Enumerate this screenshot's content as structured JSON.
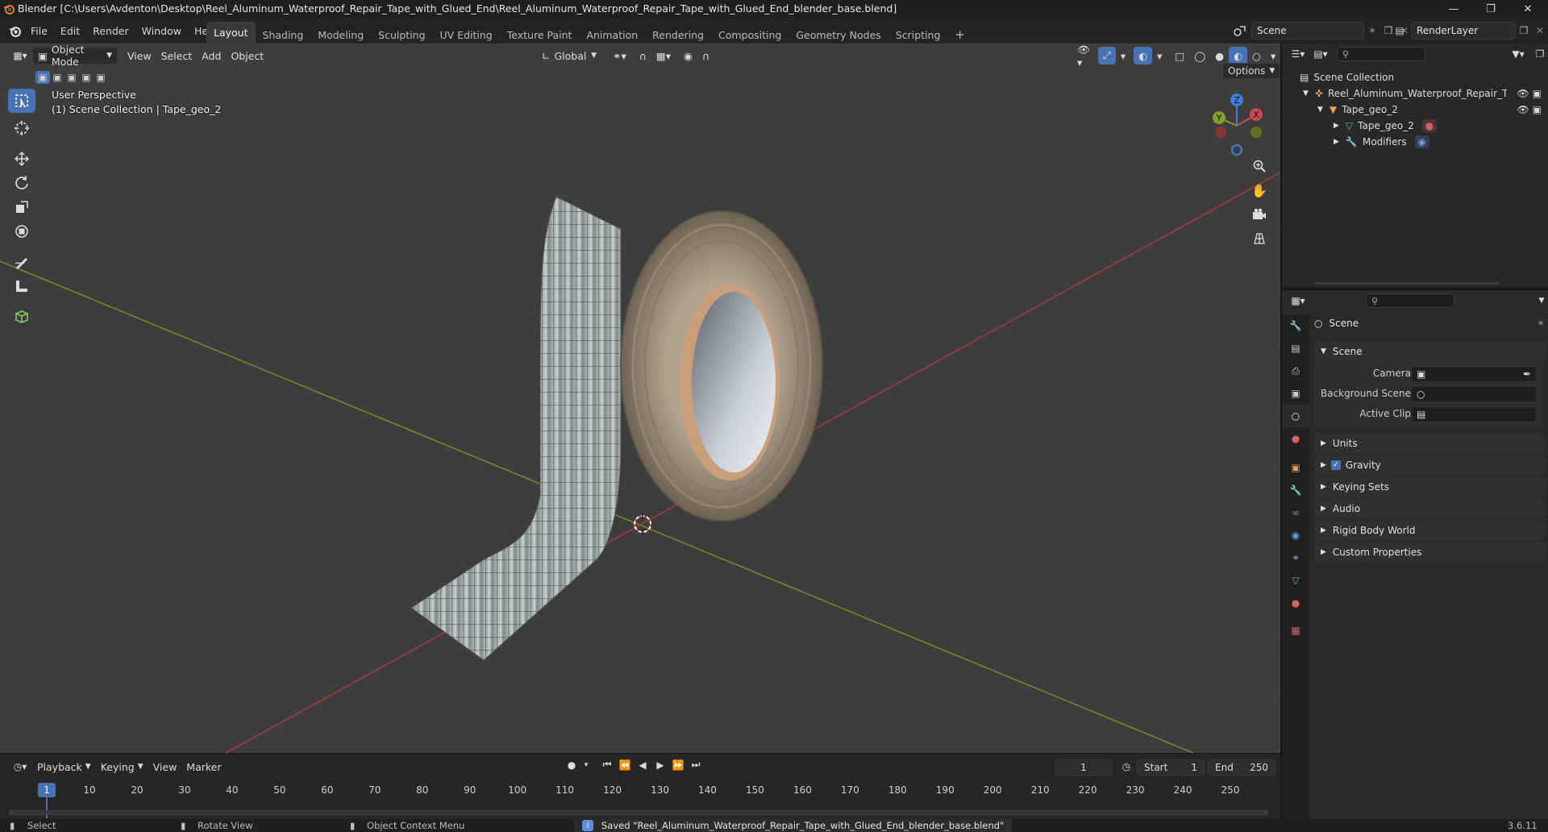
{
  "window": {
    "title": "Blender [C:\\Users\\Avdenton\\Desktop\\Reel_Aluminum_Waterproof_Repair_Tape_with_Glued_End\\Reel_Aluminum_Waterproof_Repair_Tape_with_Glued_End_blender_base.blend]"
  },
  "menubar": {
    "menus": [
      "File",
      "Edit",
      "Render",
      "Window",
      "Help"
    ],
    "workspaces": [
      "Layout",
      "Shading",
      "Modeling",
      "Sculpting",
      "UV Editing",
      "Texture Paint",
      "Animation",
      "Rendering",
      "Compositing",
      "Geometry Nodes",
      "Scripting"
    ],
    "active_workspace": "Layout",
    "scene_name": "Scene",
    "view_layer": "RenderLayer"
  },
  "viewport": {
    "mode": "Object Mode",
    "menus": [
      "View",
      "Select",
      "Add",
      "Object"
    ],
    "transform_orientation": "Global",
    "options_label": "Options",
    "perspective_label": "User Perspective",
    "collection_label": "(1) Scene Collection | Tape_geo_2",
    "gizmo_axes": {
      "x": "X",
      "y": "Y",
      "z": "Z"
    }
  },
  "outliner": {
    "root": "Scene Collection",
    "items": [
      {
        "label": "Reel_Aluminum_Waterproof_Repair_Tap",
        "depth": 1
      },
      {
        "label": "Tape_geo_2",
        "depth": 2
      },
      {
        "label": "Tape_geo_2",
        "depth": 3
      },
      {
        "label": "Modifiers",
        "depth": 3
      }
    ]
  },
  "properties": {
    "context_title": "Scene",
    "section_title": "Scene",
    "fields": [
      {
        "label": "Camera",
        "value": ""
      },
      {
        "label": "Background Scene",
        "value": ""
      },
      {
        "label": "Active Clip",
        "value": ""
      }
    ],
    "panels": [
      "Units",
      "Gravity",
      "Keying Sets",
      "Audio",
      "Rigid Body World",
      "Custom Properties"
    ],
    "gravity_checked": true
  },
  "timeline": {
    "menus": [
      "Playback",
      "Keying",
      "View",
      "Marker"
    ],
    "current_frame": "1",
    "start_label": "Start",
    "start_value": "1",
    "end_label": "End",
    "end_value": "250",
    "ticks": [
      "1",
      "10",
      "20",
      "30",
      "40",
      "50",
      "60",
      "70",
      "80",
      "90",
      "100",
      "110",
      "120",
      "130",
      "140",
      "150",
      "160",
      "170",
      "180",
      "190",
      "200",
      "210",
      "220",
      "230",
      "240",
      "250"
    ]
  },
  "statusbar": {
    "select": "Select",
    "rotate": "Rotate View",
    "context_menu": "Object Context Menu",
    "message": "Saved \"Reel_Aluminum_Waterproof_Repair_Tape_with_Glued_End_blender_base.blend\"",
    "version": "3.6.11"
  },
  "colors": {
    "accent": "#4772b3",
    "x_axis": "#c84b50",
    "y_axis": "#7fa02c",
    "z_axis": "#3d7fd8"
  }
}
